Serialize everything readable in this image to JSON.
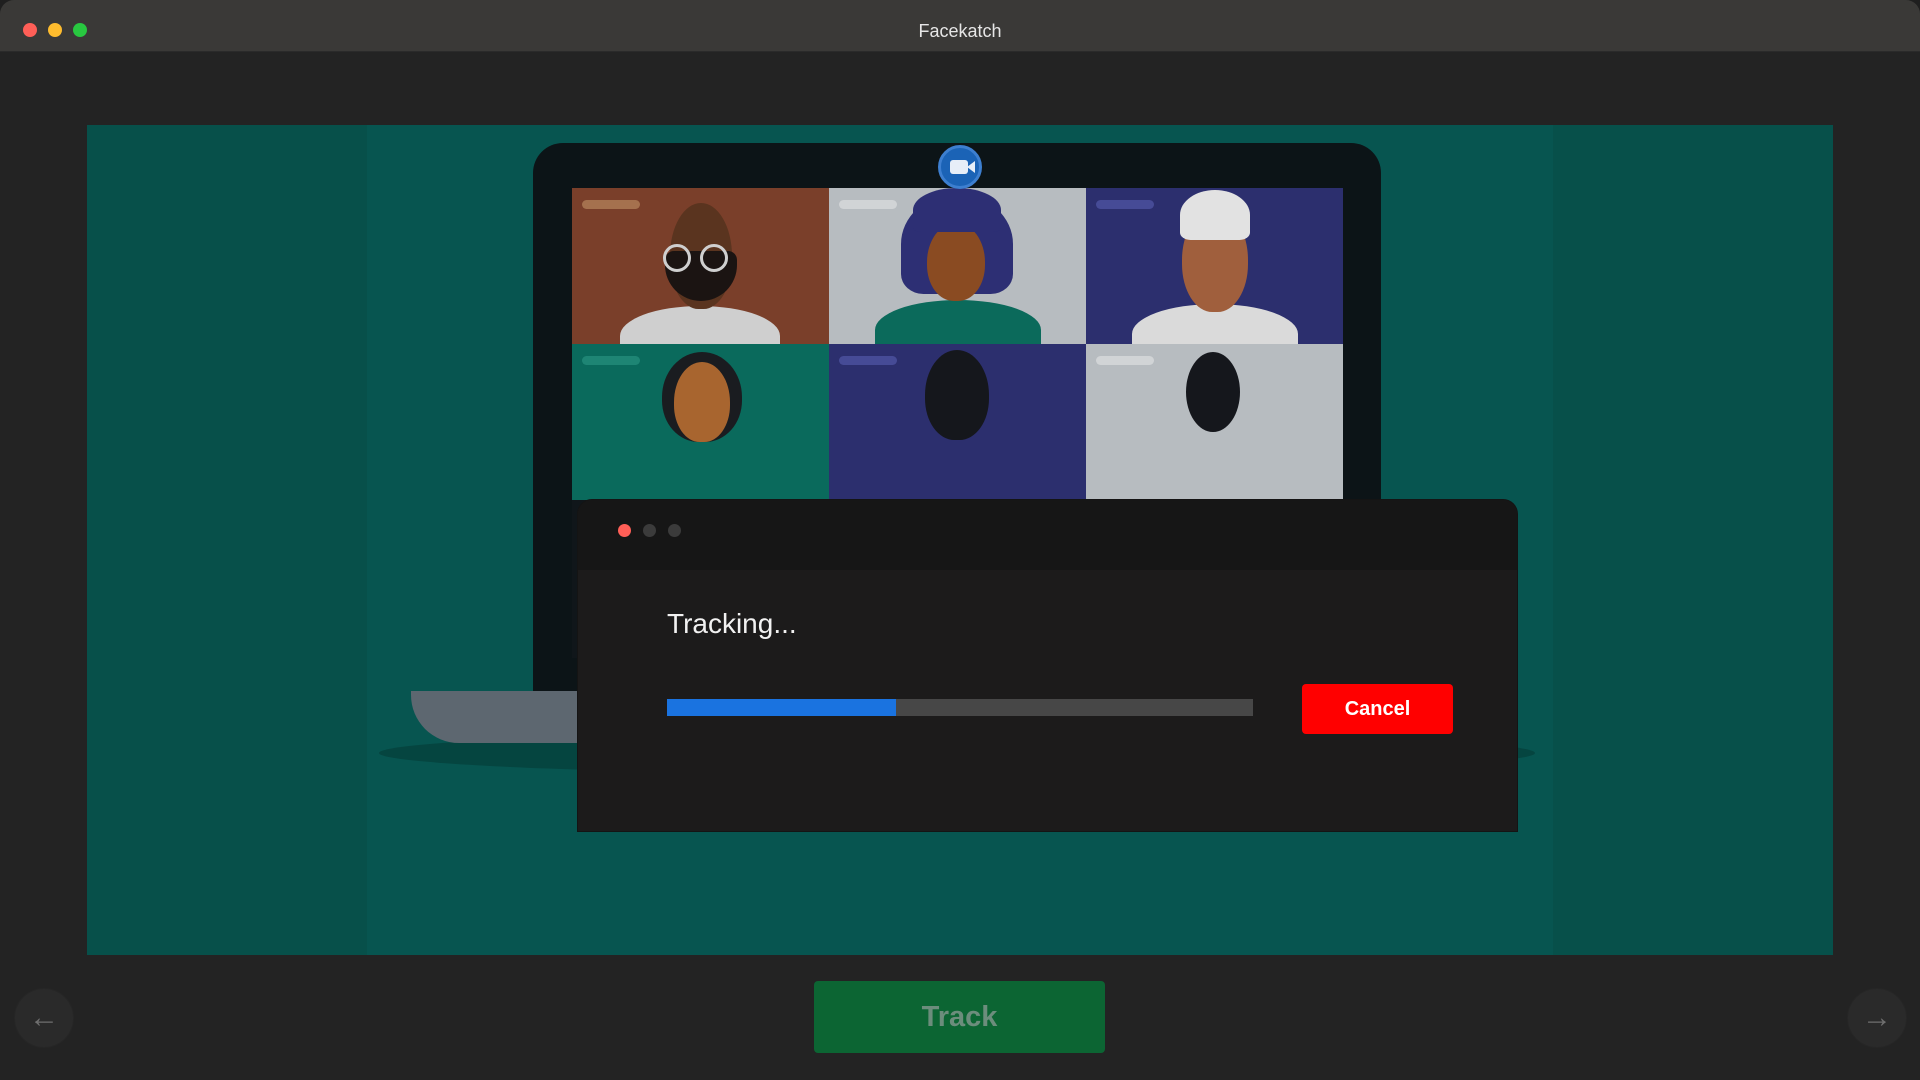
{
  "window": {
    "title": "Facekatch"
  },
  "dialog": {
    "status_text": "Tracking...",
    "progress_percent": 39,
    "cancel_label": "Cancel"
  },
  "footer": {
    "track_label": "Track",
    "prev_icon": "arrow-left-icon",
    "next_icon": "arrow-right-icon",
    "prev_glyph": "←",
    "next_glyph": "→"
  },
  "colors": {
    "stage_background": "#07504a",
    "progress_fill": "#1a73e0",
    "cancel_button": "#ff0000",
    "track_button": "#0c6533"
  },
  "illustration": {
    "video_call_icon": "video-camera-icon",
    "participants": [
      "participant-1",
      "participant-2",
      "participant-3",
      "participant-4",
      "participant-5",
      "participant-6"
    ]
  }
}
